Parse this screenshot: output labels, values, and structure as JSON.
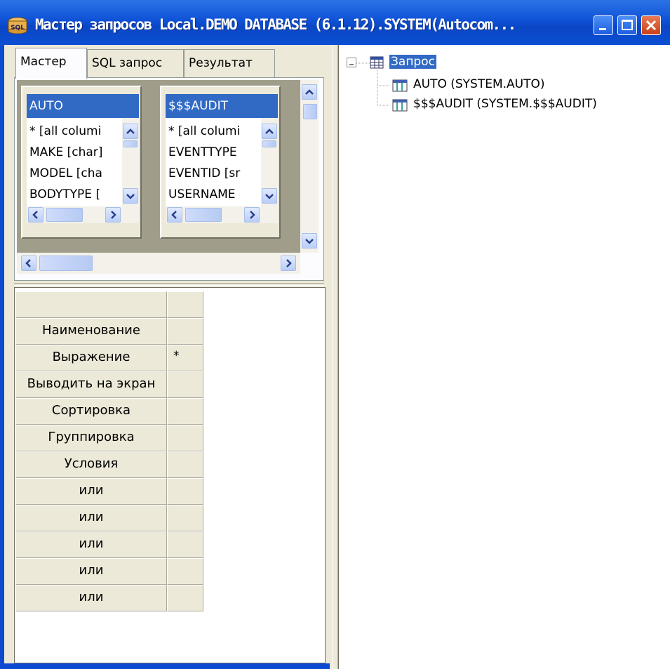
{
  "window": {
    "title": "Мастер запросов Local.DEMO DATABASE (6.1.12).SYSTEM(Autocom...",
    "icon_label": "SQL",
    "buttons": [
      "minimize-icon",
      "maximize-icon",
      "close-icon"
    ]
  },
  "tabs": [
    {
      "label": "Мастер",
      "active": true
    },
    {
      "label": "SQL запрос",
      "active": false
    },
    {
      "label": "Результат",
      "active": false
    }
  ],
  "tables": [
    {
      "name": "AUTO",
      "rows": [
        "* [all columi",
        "MAKE [char]",
        "MODEL [cha",
        "BODYTYPE ["
      ]
    },
    {
      "name": "$$$AUDIT",
      "rows": [
        "* [all columi",
        "EVENTTYPE",
        "EVENTID [sr",
        "USERNAME"
      ]
    }
  ],
  "grid": {
    "rows": [
      "",
      "Наименование",
      "Выражение",
      "Выводить на экран",
      "Сортировка",
      "Группировка",
      "Условия",
      "или",
      "или",
      "или",
      "или",
      "или"
    ],
    "values": [
      "",
      "",
      "*",
      "",
      "",
      "",
      "",
      "",
      "",
      "",
      "",
      ""
    ]
  },
  "tree": {
    "root": "Запрос",
    "children": [
      "AUTO (SYSTEM.AUTO)",
      "$$$AUDIT (SYSTEM.$$$AUDIT)"
    ],
    "expander": "⊟"
  },
  "colors": {
    "titlebar": "#0f52d6",
    "selection": "#316ac5",
    "face": "#ece9d8",
    "canvas": "#a09e8a"
  }
}
